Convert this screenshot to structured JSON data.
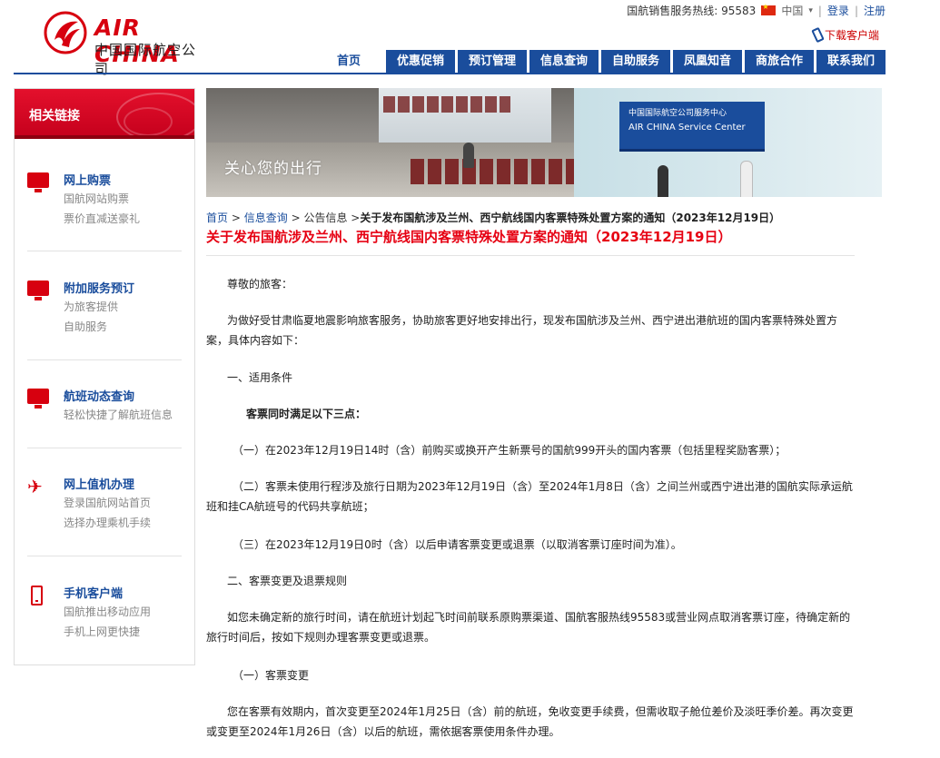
{
  "logo": {
    "en": "AIR CHINA",
    "cn": "中国国际航空公司"
  },
  "topbar": {
    "hotline": "国航销售服务热线: 95583",
    "region": "中国",
    "login": "登录",
    "register": "注册",
    "download": "下载客户端"
  },
  "nav": {
    "items": [
      "首页",
      "优惠促销",
      "预订管理",
      "信息查询",
      "自助服务",
      "凤凰知音",
      "商旅合作",
      "联系我们"
    ]
  },
  "sidebar": {
    "heading": "相关链接",
    "items": [
      {
        "title": "网上购票",
        "sub1": "国航网站购票",
        "sub2": "票价直减送豪礼",
        "icon": "monitor-icon"
      },
      {
        "title": "附加服务预订",
        "sub1": "为旅客提供",
        "sub2": "自助服务",
        "icon": "monitor-icon"
      },
      {
        "title": "航班动态查询",
        "sub1": "轻松快捷了解航班信息",
        "sub2": "",
        "icon": "monitor-icon"
      },
      {
        "title": "网上值机办理",
        "sub1": "登录国航网站首页",
        "sub2": "选择办理乘机手续",
        "icon": "plane-icon"
      },
      {
        "title": "手机客户端",
        "sub1": "国航推出移动应用",
        "sub2": "手机上网更快捷",
        "icon": "mobile-icon"
      }
    ]
  },
  "banner": {
    "caption": "关心您的出行",
    "sign_cn": "中国国际航空公司服务中心",
    "sign_en": "AIR CHINA Service Center"
  },
  "breadcrumb": {
    "home": "首页",
    "info": "信息查询",
    "notice": "公告信息",
    "current": "关于发布国航涉及兰州、西宁航线国内客票特殊处置方案的通知（2023年12月19日）"
  },
  "article": {
    "title": "关于发布国航涉及兰州、西宁航线国内客票特殊处置方案的通知（2023年12月19日）",
    "salutation": "尊敬的旅客：",
    "p1": "为做好受甘肃临夏地震影响旅客服务，协助旅客更好地安排出行，现发布国航涉及兰州、西宁进出港航班的国内客票特殊处置方案，具体内容如下：",
    "s1": "一、适用条件",
    "s1_bold": "客票同时满足以下三点：",
    "c1": "（一）在2023年12月19日14时（含）前购买或换开产生新票号的国航999开头的国内客票（包括里程奖励客票）；",
    "c2": "（二）客票未使用行程涉及旅行日期为2023年12月19日（含）至2024年1月8日（含）之间兰州或西宁进出港的国航实际承运航班和挂CA航班号的代码共享航班；",
    "c3": "（三）在2023年12月19日0时（含）以后申请客票变更或退票（以取消客票订座时间为准）。",
    "s2": "二、客票变更及退票规则",
    "p2": "如您未确定新的旅行时间，请在航班计划起飞时间前联系原购票渠道、国航客服热线95583或营业网点取消客票订座，待确定新的旅行时间后，按如下规则办理客票变更或退票。",
    "s2_1": "（一）客票变更",
    "p3": "您在客票有效期内，首次变更至2024年1月25日（含）前的航班，免收变更手续费，但需收取子舱位差价及淡旺季价差。再次变更或变更至2024年1月26日（含）以后的航班，需依据客票使用条件办理。"
  }
}
